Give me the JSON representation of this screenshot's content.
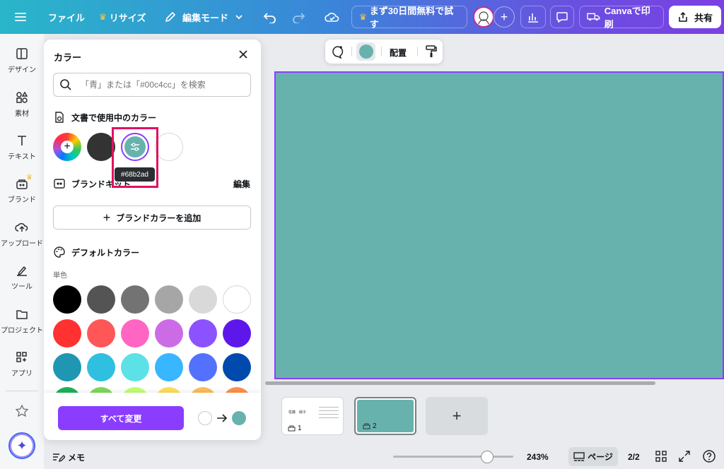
{
  "topbar": {
    "file_label": "ファイル",
    "resize_label": "リサイズ",
    "mode_label": "編集モード",
    "trial_label": "まず30日間無料で試す",
    "print_label": "Canvaで印刷",
    "share_label": "共有"
  },
  "rail": {
    "items": [
      {
        "label": "デザイン",
        "icon": "layout-icon"
      },
      {
        "label": "素材",
        "icon": "shapes-icon"
      },
      {
        "label": "テキスト",
        "icon": "text-icon"
      },
      {
        "label": "ブランド",
        "icon": "brand-icon"
      },
      {
        "label": "アップロード",
        "icon": "upload-icon"
      },
      {
        "label": "ツール",
        "icon": "draw-icon"
      },
      {
        "label": "プロジェクト",
        "icon": "folder-icon"
      },
      {
        "label": "アプリ",
        "icon": "apps-icon"
      }
    ]
  },
  "color_panel": {
    "title": "カラー",
    "search_placeholder": "「青」または「#00c4cc」を検索",
    "doc_colors_title": "文書で使用中のカラー",
    "doc_colors": [
      "#333333",
      "#68b2ad",
      "#ffffff"
    ],
    "tooltip": "#68b2ad",
    "brand_kit_title": "ブランドキット",
    "edit_label": "編集",
    "add_brand_color_label": "ブランドカラーを追加",
    "default_colors_title": "デフォルトカラー",
    "solid_label": "単色",
    "palette": [
      [
        "#000000",
        "#545454",
        "#737373",
        "#a6a6a6",
        "#d9d9d9",
        "#ffffff"
      ],
      [
        "#ff3131",
        "#ff5757",
        "#ff66c4",
        "#cb6ce6",
        "#8c52ff",
        "#5e17eb"
      ],
      [
        "#1f97b3",
        "#2fbfe0",
        "#5ce1e6",
        "#38b6ff",
        "#5271ff",
        "#004aad"
      ],
      [
        "#1eb15a",
        "#7ed957",
        "#c1ff72",
        "#ffde59",
        "#ffbd59",
        "#ff914d"
      ]
    ],
    "change_all_label": "すべて変更",
    "from_color": "#ffffff",
    "to_color": "#68b2ad"
  },
  "float_toolbar": {
    "color": "#68b2ad",
    "position_label": "配置"
  },
  "canvas": {
    "page_color": "#68b2ad"
  },
  "thumbnails": [
    {
      "number": "1",
      "title": "佐藤　緑子"
    },
    {
      "number": "2"
    }
  ],
  "bottombar": {
    "notes_label": "メモ",
    "zoom": "243%",
    "pages_label": "ページ",
    "page_count": "2/2",
    "zoom_level": 0.78
  }
}
